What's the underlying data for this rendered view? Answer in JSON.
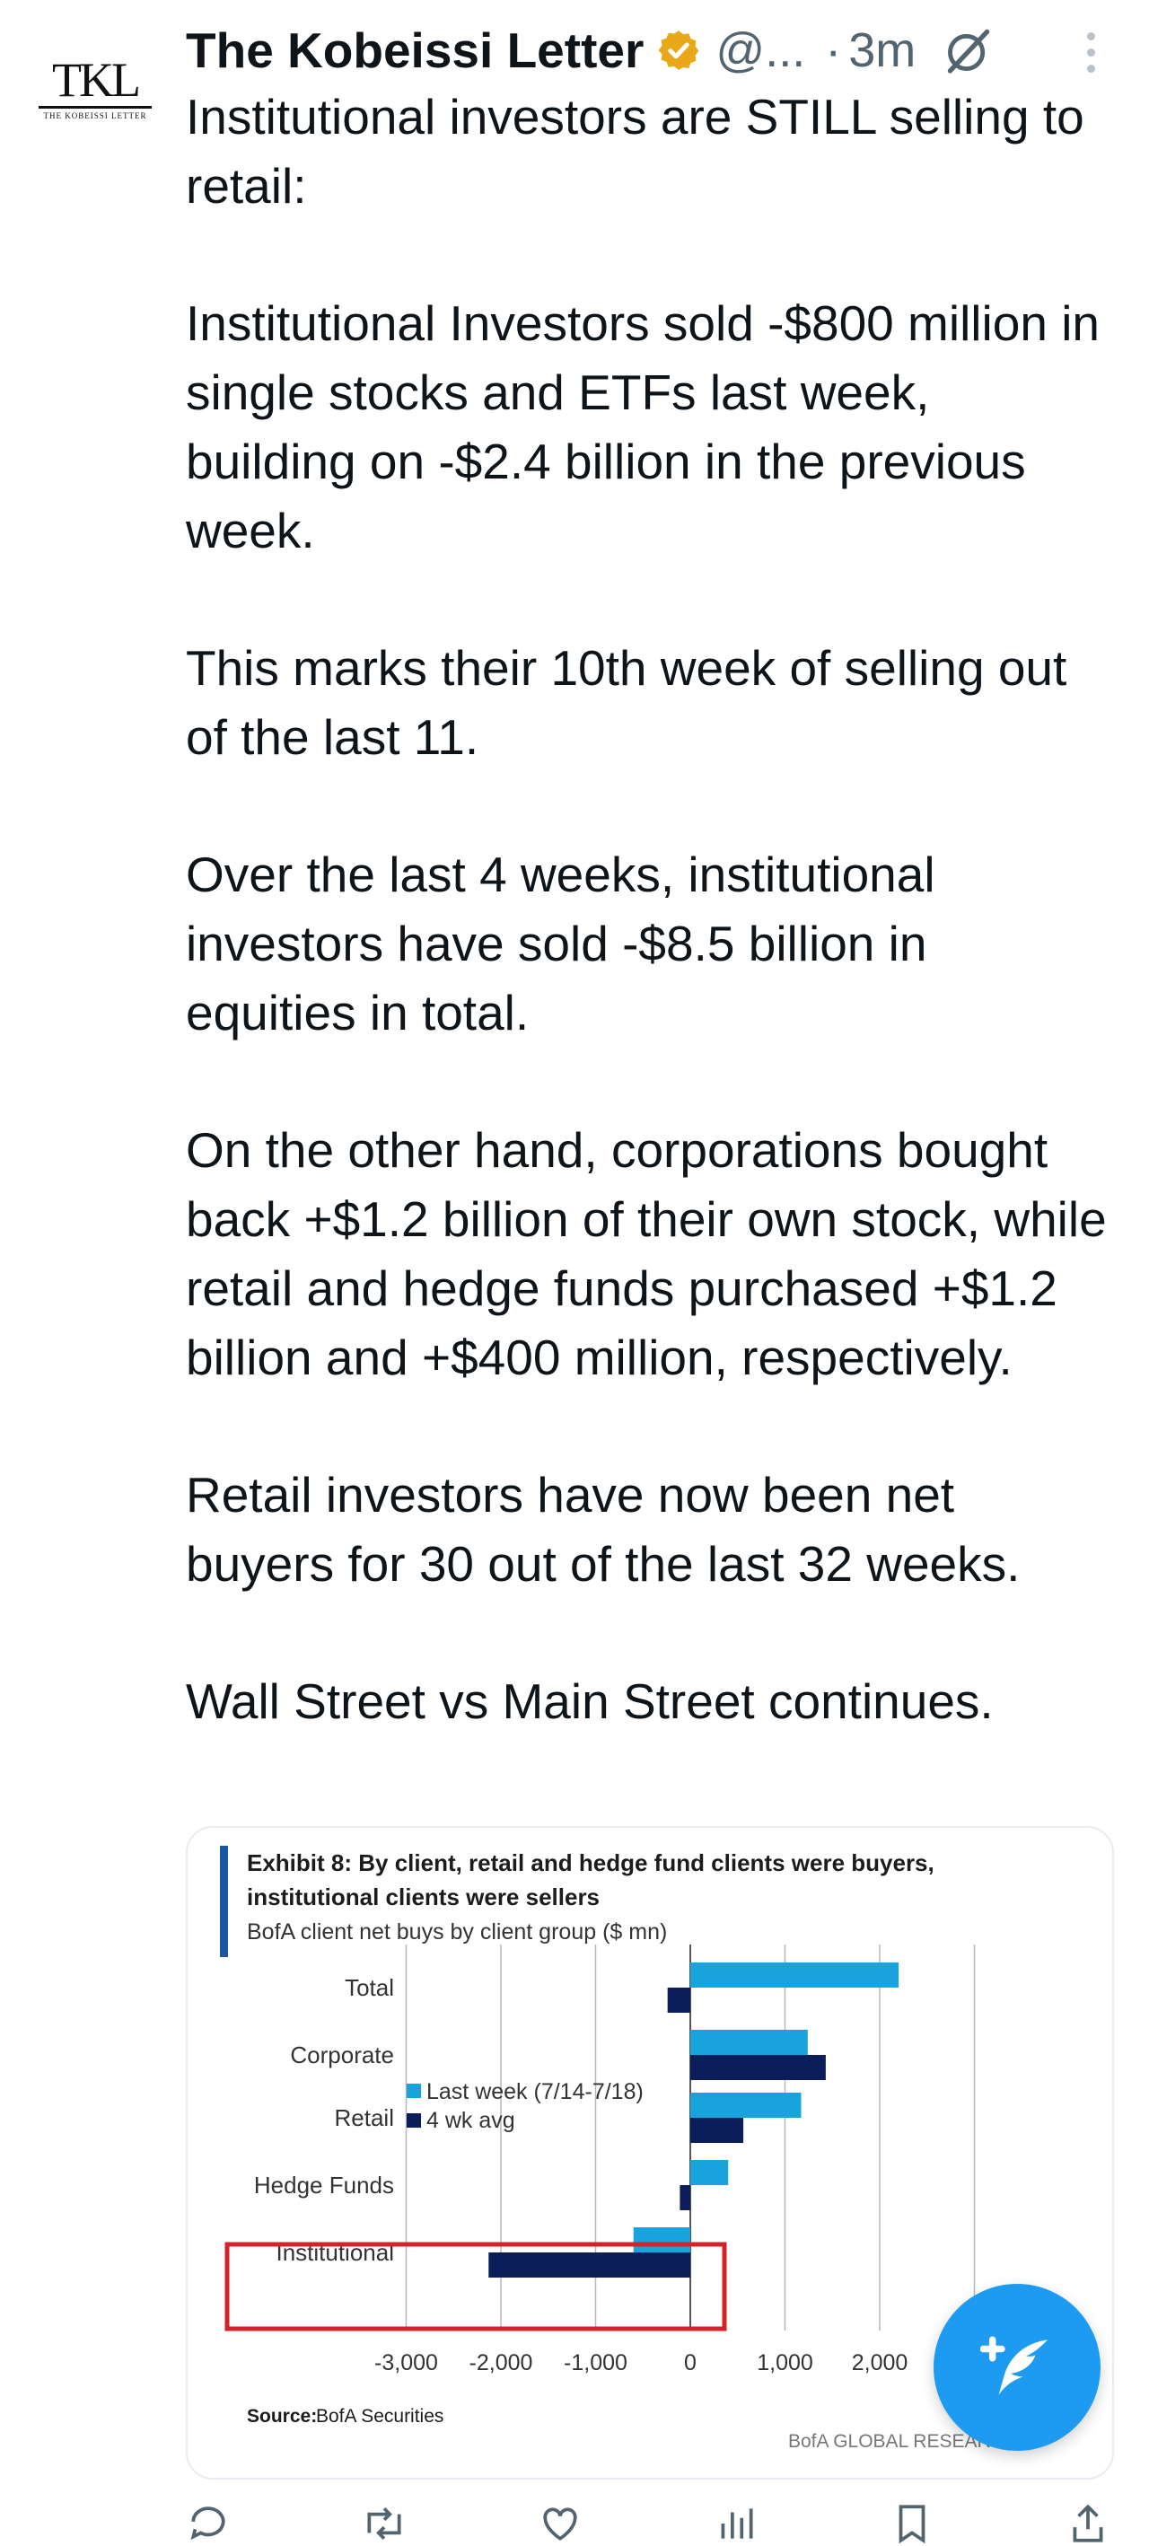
{
  "tweet": {
    "author_name": "The Kobeissi Letter",
    "handle": "@...",
    "separator": "·",
    "time": "3m",
    "avatar_text": "TKL",
    "avatar_subtext": "THE KOBEISSI LETTER",
    "paragraphs": [
      "Institutional investors are STILL selling to retail:",
      "Institutional Investors sold -$800 million in single stocks and ETFs last week, building on -$2.4 billion in the previous week.",
      "This marks their 10th week of selling out of the last 11.",
      "Over the last 4 weeks, institutional investors have sold -$8.5 billion in equities in total.",
      "On the other hand, corporations bought back +$1.2 billion of their own stock, while retail and hedge funds purchased +$1.2 billion and +$400 million, respectively.",
      "Retail investors have now been net buyers for 30 out of the last 32 weeks.",
      "Wall Street vs Main Street continues."
    ],
    "icons": {
      "verified": "verified-badge-icon",
      "grok": "grok-icon",
      "more": "more-options-icon",
      "compose": "compose-post-icon"
    },
    "colors": {
      "verified": "#e8a817",
      "accent": "#1d9bf0",
      "secondary_text": "#536471"
    }
  },
  "chart_data": {
    "type": "bar",
    "orientation": "horizontal",
    "title_line1": "Exhibit 8: By client, retail and hedge fund clients were buyers,",
    "title_line2": "institutional clients were sellers",
    "subtitle": "BofA client net buys by client group ($ mn)",
    "categories": [
      "Total",
      "Corporate",
      "Retail",
      "Hedge Funds",
      "Institutional"
    ],
    "series": [
      {
        "name": "Last week (7/14-7/18)",
        "color": "#19a3dd",
        "values": [
          2200,
          1240,
          1170,
          400,
          -600
        ]
      },
      {
        "name": "4 wk avg",
        "color": "#0b1e5b",
        "values": [
          -240,
          1430,
          560,
          -110,
          -2130
        ]
      }
    ],
    "x_ticks": [
      -3000,
      -2000,
      -1000,
      0,
      1000,
      2000
    ],
    "x_tick_labels": [
      "-3,000",
      "-2,000",
      "-1,000",
      "0",
      "1,000",
      "2,000"
    ],
    "xlim": [
      -3000,
      3000
    ],
    "grid": true,
    "legend_position": "center-left",
    "highlight_category": "Institutional",
    "highlight_color": "#d2232a",
    "source_label": "Source:",
    "source_text": "BofA Securities",
    "footer": "BofA GLOBAL RESEARCH",
    "accent_bar_color": "#1a56a8"
  },
  "actions": [
    {
      "icon": "reply-icon"
    },
    {
      "icon": "repost-icon"
    },
    {
      "icon": "like-icon"
    },
    {
      "icon": "views-icon"
    },
    {
      "icon": "bookmark-icon"
    },
    {
      "icon": "share-icon"
    }
  ]
}
